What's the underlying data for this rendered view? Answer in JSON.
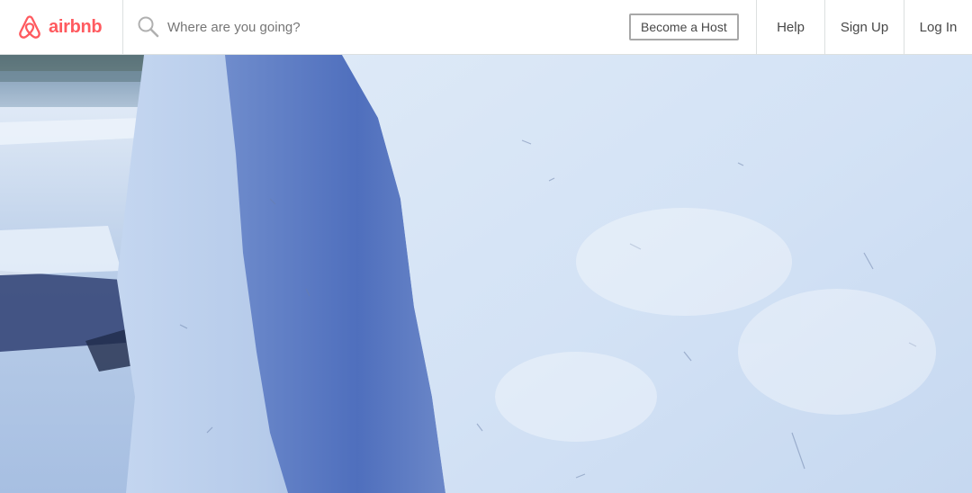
{
  "header": {
    "logo": {
      "icon": "airbnb-belo-icon",
      "text": "airbnb",
      "color": "#ff5a5f"
    },
    "search": {
      "icon": "search-icon",
      "placeholder": "Where are you going?",
      "value": ""
    },
    "become_host_label": "Become a Host",
    "nav": {
      "help_label": "Help",
      "signup_label": "Sign Up",
      "login_label": "Log In"
    }
  },
  "hero": {
    "image": "snow-pillar-photo"
  },
  "colors": {
    "brand": "#ff5a5f",
    "text": "#484848",
    "placeholder": "#767676",
    "divider": "#dce0e0",
    "button_border": "#a8a8a8"
  }
}
